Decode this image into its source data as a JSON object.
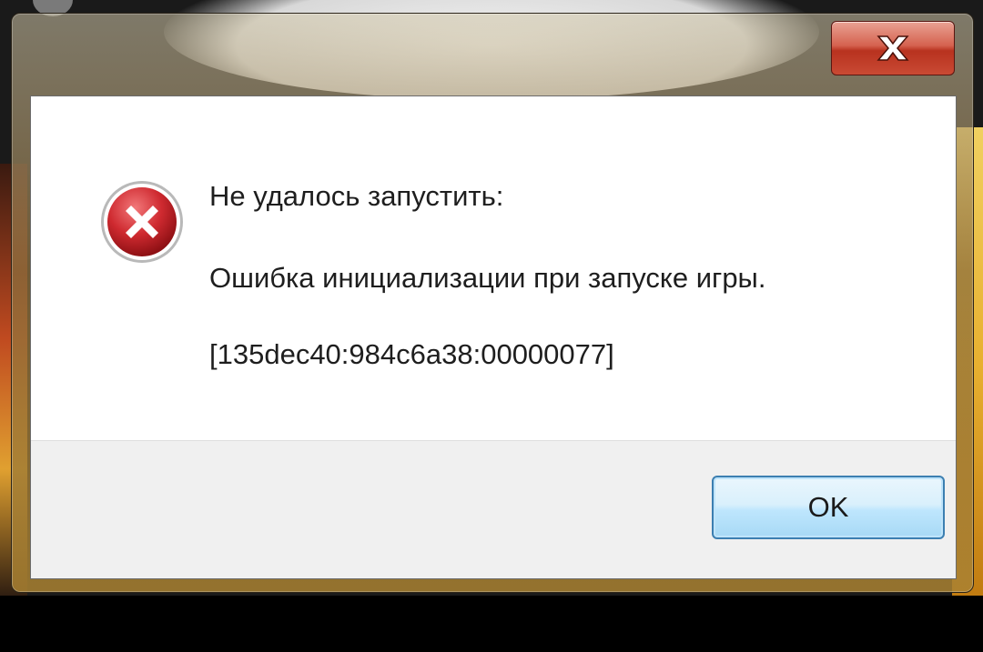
{
  "dialog": {
    "close_icon": "close-icon",
    "error_icon": "error-icon",
    "heading": "Не удалось запустить:",
    "detail": "Ошибка инициализации при запуске игры.",
    "error_code": "[135dec40:984c6a38:00000077]",
    "ok_label": "OK"
  },
  "colors": {
    "error_red": "#c8202a",
    "close_button_red": "#c94a34",
    "ok_button_border": "#3c7fb1",
    "footer_bg": "#f0f0f0"
  }
}
